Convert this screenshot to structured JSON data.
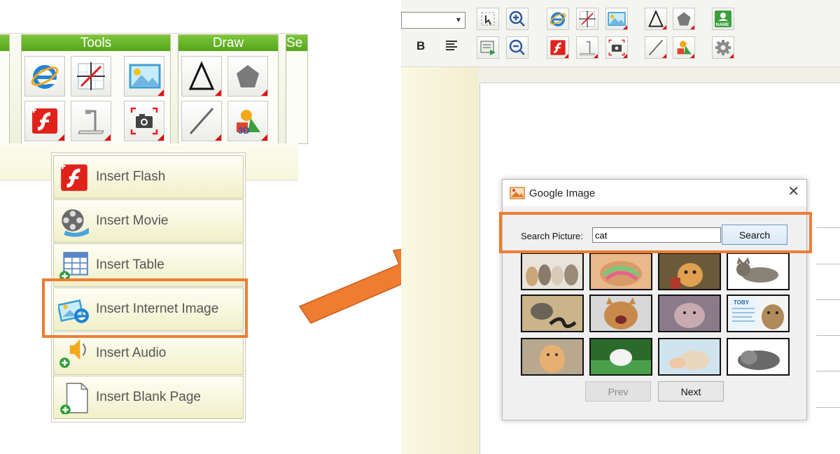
{
  "left_toolbar": {
    "groups": {
      "tools": "Tools",
      "draw": "Draw",
      "partial": "Se"
    }
  },
  "insert_menu": {
    "items": [
      {
        "label": "Insert Flash",
        "icon": "flash-icon"
      },
      {
        "label": "Insert Movie",
        "icon": "film-reel-icon"
      },
      {
        "label": "Insert Table",
        "icon": "table-icon"
      },
      {
        "label": "Insert Internet Image",
        "icon": "internet-image-icon"
      },
      {
        "label": "Insert Audio",
        "icon": "speaker-icon"
      },
      {
        "label": "Insert Blank Page",
        "icon": "blank-page-icon"
      }
    ]
  },
  "right_toolbar": {
    "bold_label": "B",
    "name_badge": "NAME",
    "threed_label": "3D"
  },
  "dialog": {
    "title": "Google Image",
    "close": "✕",
    "search_label": "Search Picture:",
    "search_value": "cat",
    "search_button": "Search",
    "prev_button": "Prev",
    "next_button": "Next",
    "thumbnails_count_note": "12 cat images",
    "poster_text": "TOBY"
  },
  "colors": {
    "highlight": "#ee7d31",
    "group_header": "#62b226"
  }
}
